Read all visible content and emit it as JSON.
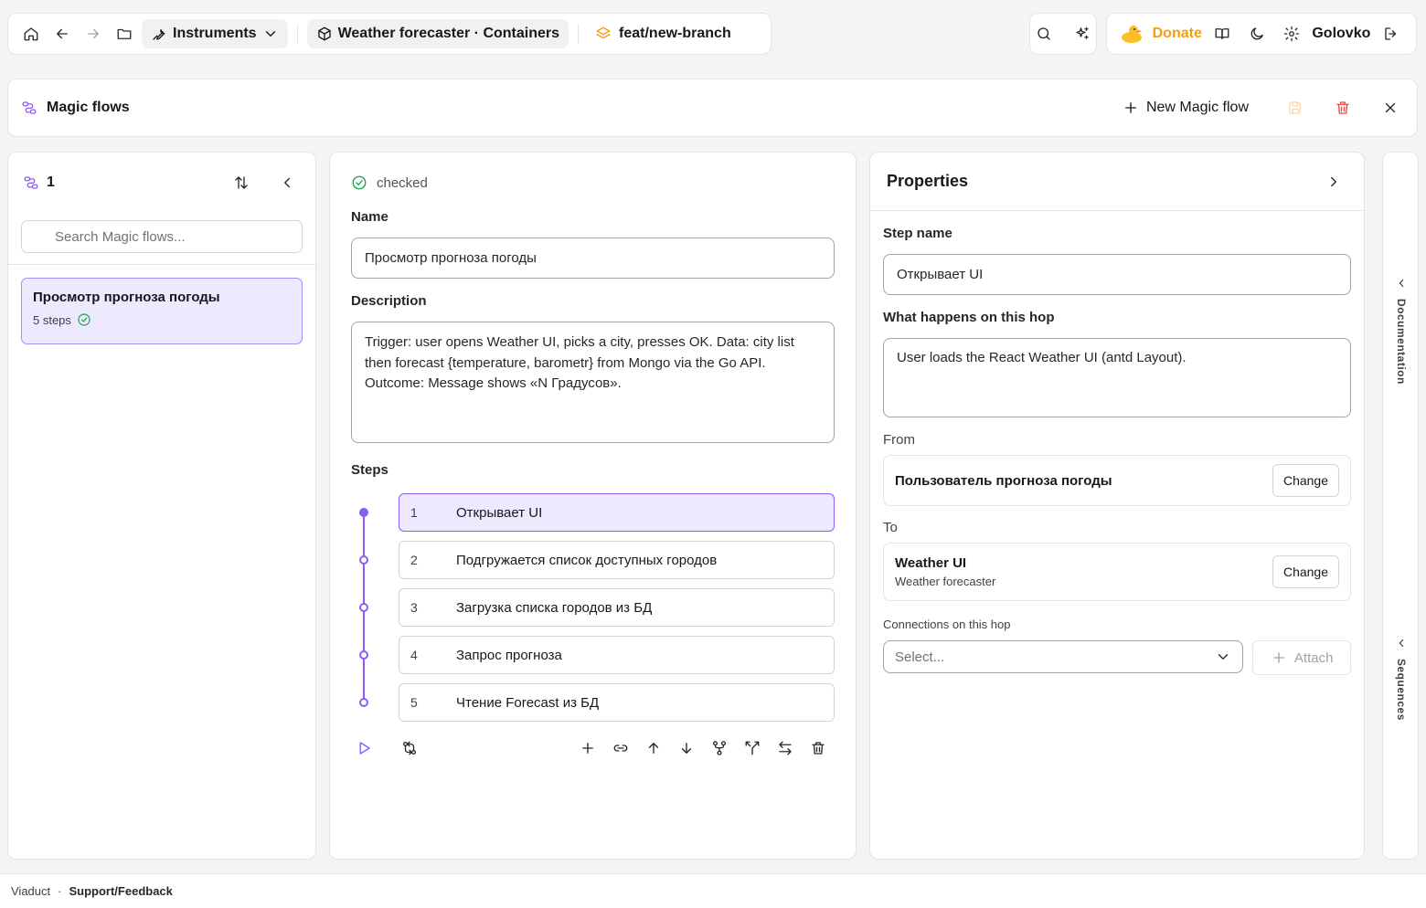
{
  "topbar": {
    "instruments_label": "Instruments",
    "project_label": "Weather forecaster · Containers",
    "branch_label": "feat/new-branch",
    "donate_label": "Donate",
    "username": "Golovko"
  },
  "magic_flows": {
    "title": "Magic flows",
    "new_label": "New Magic flow"
  },
  "left_panel": {
    "count": "1",
    "search_placeholder": "Search Magic flows...",
    "items": [
      {
        "name": "Просмотр прогноза погоды",
        "meta": "5 steps"
      }
    ]
  },
  "editor": {
    "status": "checked",
    "name_label": "Name",
    "name_value": "Просмотр прогноза погоды",
    "description_label": "Description",
    "description_value": "Trigger: user opens Weather UI, picks a city, presses OK. Data: city list then forecast {temperature, barometr} from Mongo via the Go API. Outcome: Message shows «N Градусов».",
    "steps_label": "Steps",
    "steps": [
      {
        "num": "1",
        "label": "Открывает UI"
      },
      {
        "num": "2",
        "label": "Подгружается список доступных городов"
      },
      {
        "num": "3",
        "label": "Загрузка списка городов из БД"
      },
      {
        "num": "4",
        "label": "Запрос прогноза"
      },
      {
        "num": "5",
        "label": "Чтение Forecast из БД"
      }
    ]
  },
  "properties": {
    "title": "Properties",
    "step_name_label": "Step name",
    "step_name_value": "Открывает UI",
    "what_label": "What happens on this hop",
    "what_value": "User loads the React Weather UI (antd Layout).",
    "from_label": "From",
    "from_value": "Пользователь прогноза погоды",
    "to_label": "To",
    "to_value": "Weather UI",
    "to_sub": "Weather forecaster",
    "change_label": "Change",
    "connections_label": "Connections on this hop",
    "select_placeholder": "Select...",
    "attach_label": "Attach"
  },
  "side": {
    "documentation": "Documentation",
    "sequences": "Sequences"
  },
  "footer": {
    "brand": "Viaduct",
    "dot": "·",
    "support": "Support/Feedback"
  },
  "colors": {
    "accent": "#8b5cf6",
    "accent_bg": "#ede9fe",
    "donate": "#f59e0b",
    "danger": "#ef4444",
    "success": "#16a34a"
  }
}
